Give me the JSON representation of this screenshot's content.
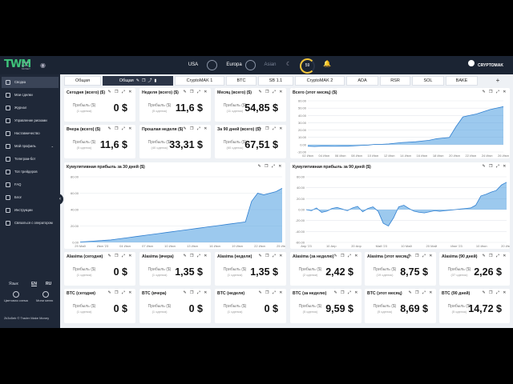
{
  "brand": {
    "logo": "TWM",
    "logo_sub": "TRADE MAKE MONEY"
  },
  "header": {
    "regions": [
      "USA",
      "Europa",
      "Asian"
    ],
    "gauge_value": "59",
    "user_name": "CRYPTOMAK"
  },
  "sidebar": {
    "items": [
      {
        "label": "Сводка",
        "active": true
      },
      {
        "label": "Мои сделки"
      },
      {
        "label": "Журнал"
      },
      {
        "label": "Управление рисками"
      },
      {
        "label": "Наставничество"
      },
      {
        "label": "Мой профиль",
        "arrow": "❯"
      },
      {
        "label": "Телеграм-бот"
      },
      {
        "label": "Топ трейдеров"
      },
      {
        "label": "FAQ"
      },
      {
        "label": "Блог"
      },
      {
        "label": "Инструкции"
      },
      {
        "label": "Связаться с оператором"
      }
    ],
    "language_label": "Язык",
    "languages": [
      "EN",
      "RU"
    ],
    "color_scheme": "Цветовая схема",
    "mini_menu": "Мини меню",
    "copyright": "2k3o5eb © Trader Make Money"
  },
  "tabs": [
    {
      "label": "Общая"
    },
    {
      "label": "Общая",
      "active": true
    },
    {
      "label": "CryptoMAK 1"
    },
    {
      "label": "BTC"
    },
    {
      "label": "SB 1.1"
    },
    {
      "label": "CryptoMAK 2"
    },
    {
      "label": "ADA"
    },
    {
      "label": "RSR"
    },
    {
      "label": "SOL"
    },
    {
      "label": "BAKE"
    }
  ],
  "add_tab": "+",
  "stats": [
    {
      "title": "Сегодня (всего) ($)",
      "label": "Прибыль ($)",
      "sub": "(1 сделка)",
      "value": "0 $"
    },
    {
      "title": "Неделя (всего) ($)",
      "label": "Прибыль ($)",
      "sub": "(5 сделок)",
      "value": "11,6 $"
    },
    {
      "title": "Месяц (всего) ($)",
      "label": "Прибыль ($)",
      "sub": "(11 сделок)",
      "value": "54,85 $"
    },
    {
      "title": "Вчера (всего) ($)",
      "label": "Прибыль ($)",
      "sub": "(5 сделок)",
      "value": "11,6 $"
    },
    {
      "title": "Прошлая неделя ($)",
      "label": "Прибыль ($)",
      "sub": "(40 сделок)",
      "value": "33,31 $"
    },
    {
      "title": "За 90 дней (всего) ($)",
      "label": "Прибыль ($)",
      "sub": "(60 сделок)",
      "value": "67,51 $"
    },
    {
      "title": "Alasima (сегодня)",
      "label": "Прибыль ($)",
      "sub": "(1 сделка)",
      "value": "0 $"
    },
    {
      "title": "Alasima (вчера)",
      "label": "Прибыль ($)",
      "sub": "(1 сделка)",
      "value": "1,35 $"
    },
    {
      "title": "Alasima (неделя)",
      "label": "Прибыль ($)",
      "sub": "(1 сделка)",
      "value": "1,35 $"
    },
    {
      "title": "Alasima (за неделю)",
      "label": "Прибыль ($)",
      "sub": "(2 сделки)",
      "value": "2,42 $"
    },
    {
      "title": "Alasima (этот месяц)",
      "label": "Прибыль ($)",
      "sub": "(19 сделок)",
      "value": "8,75 $"
    },
    {
      "title": "Alasima (90 дней)",
      "label": "Прибыль ($)",
      "sub": "(37 сделок)",
      "value": "2,26 $"
    },
    {
      "title": "BTC (сегодня)",
      "label": "Прибыль ($)",
      "sub": "(1 сделка)",
      "value": "0 $"
    },
    {
      "title": "BTC (вчера)",
      "label": "Прибыль ($)",
      "sub": "(1 сделка)",
      "value": "0 $"
    },
    {
      "title": "BTC (неделя)",
      "label": "Прибыль ($)",
      "sub": "(1 сделка)",
      "value": "0 $"
    },
    {
      "title": "BTC (за неделю)",
      "label": "Прибыль ($)",
      "sub": "(5 сделок)",
      "value": "9,59 $"
    },
    {
      "title": "BTC (этот месяц)",
      "label": "Прибыль ($)",
      "sub": "(5 сделок)",
      "value": "8,69 $"
    },
    {
      "title": "BTC (90 дней)",
      "label": "Прибыль ($)",
      "sub": "(5 сделок)",
      "value": "14,72 $"
    }
  ],
  "chart_data": [
    {
      "type": "area",
      "title": "Всего (этот месяц) ($)",
      "x": [
        "02 Июн",
        "04 Июн",
        "06 Июн",
        "08 Июн",
        "10 Июн",
        "12 Июн",
        "14 Июн",
        "16 Июн",
        "18 Июн",
        "20 Июн",
        "22 Июн",
        "24 Июн",
        "26 Июн"
      ],
      "ylim": [
        -10,
        60
      ],
      "yticks": [
        "60.00",
        "50.00",
        "40.00",
        "30.00",
        "20.00",
        "10.00",
        "0.00",
        "-10.00"
      ],
      "values": [
        -2,
        -2.5,
        -2,
        -2,
        -2.2,
        -2,
        -2,
        -1.5,
        -1,
        -0.5,
        0.5,
        0.5,
        1,
        2,
        3,
        3.5,
        4,
        5,
        6,
        8,
        9,
        10,
        25,
        38,
        40,
        42,
        45,
        48,
        50,
        52
      ],
      "color": "#4a9de0"
    },
    {
      "type": "area",
      "title": "Кумулятивная прибыль за 30 дней ($)",
      "x": [
        "29 Май",
        "Июн '23",
        "04 Июн",
        "07 Июн",
        "10 Июн",
        "13 Июн",
        "16 Июн",
        "19 Июн",
        "22 Июн",
        "25 Июн"
      ],
      "ylim": [
        0,
        80
      ],
      "yticks": [
        "80.00",
        "60.00",
        "40.00",
        "20.00",
        "0.00"
      ],
      "values": [
        0.5,
        1,
        1.5,
        2,
        2.5,
        3,
        4,
        5,
        6,
        7,
        8,
        9,
        10,
        11,
        12,
        13,
        14,
        15,
        16,
        17,
        18,
        19,
        20,
        21,
        22,
        23,
        24,
        25,
        50,
        60,
        58,
        60,
        62,
        66
      ],
      "color": "#4a9de0"
    },
    {
      "type": "area",
      "title": "Кумулятивная прибыль за 90 дней ($)",
      "x": [
        "Апр '23",
        "10 Апр",
        "20 Апр",
        "Май '23",
        "10 Май",
        "20 Май",
        "Июн '23",
        "10 Июн",
        "20 Июн"
      ],
      "ylim": [
        -60,
        60
      ],
      "yticks": [
        "60.00",
        "40.00",
        "20.00",
        "0.00",
        "-20.00",
        "-40.00",
        "-60.00"
      ],
      "values": [
        0,
        -2,
        3,
        -5,
        -3,
        2,
        4,
        1,
        -2,
        3,
        6,
        -4,
        2,
        5,
        -3,
        -25,
        -30,
        -15,
        5,
        8,
        2,
        -3,
        -5,
        -6,
        -4,
        -2,
        -3,
        -2,
        -1,
        0,
        1,
        2,
        3,
        8,
        25,
        28,
        32,
        35,
        45,
        50
      ],
      "color": "#4a9de0"
    }
  ]
}
